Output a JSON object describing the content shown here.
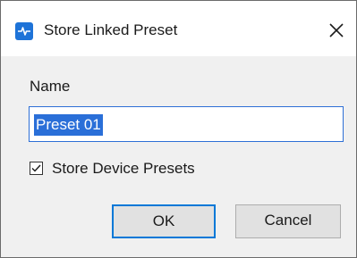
{
  "dialog": {
    "title": "Store Linked Preset",
    "app_icon": "app-waveform-icon",
    "close_icon": "close-icon"
  },
  "form": {
    "name_label": "Name",
    "name_value": "Preset 01",
    "checkbox_label": "Store Device Presets",
    "checkbox_checked": true
  },
  "buttons": {
    "ok_label": "OK",
    "cancel_label": "Cancel"
  },
  "colors": {
    "accent": "#0078d7",
    "selection": "#2a6fd8",
    "app_icon": "#1e73d8"
  }
}
